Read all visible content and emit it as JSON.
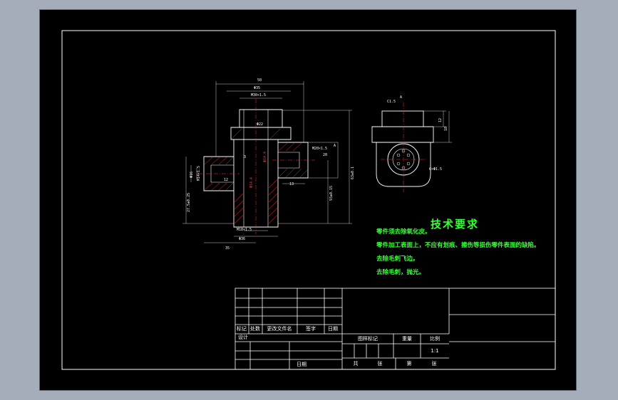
{
  "tech_requirements": {
    "title": "技术要求",
    "lines": [
      "零件须去除氧化皮。",
      "零件加工表面上，不应有划痕、擦伤等损伤零件表面的缺陷。",
      "去除毛刺飞边。",
      "去除毛刺，抛光。"
    ]
  },
  "title_block": {
    "revision_headers": [
      "标记",
      "处数",
      "更改文件名",
      "签字",
      "日期"
    ],
    "design_label": "设计",
    "date_label": "日期",
    "stage_mark_label": "图样标记",
    "weight_label": "重量",
    "scale_label": "比例",
    "scale_value": "1:1",
    "total_label": "共",
    "sheet_unit_1": "张",
    "sheet_no_label": "第",
    "sheet_unit_2": "张"
  },
  "dimensions": {
    "overall_width": "50",
    "top_bore": "Φ35",
    "top_thread": "M30×1.5",
    "inner_bore": "Φ22",
    "right_thread": "M20×1.5",
    "right_depth": "20",
    "left_dia": "Φ16",
    "left_thread": "M14×1.5",
    "bottom_thread": "M18×1.5",
    "bottom_dia": "Φ36",
    "left_length": "35",
    "mid_dim_a": "3",
    "mid_dim_b": "12",
    "mid_dim_c": "13",
    "height_a": "63±0.1",
    "height_b": "93±0.15",
    "height_c": "27.5±0.25",
    "inner_dim_a": "Φ14.4",
    "inner_dim_b": "Φ14.4",
    "section_mark": "A",
    "view_mark": "A",
    "side_chamfer": "C1.5",
    "side_height": "12",
    "side_step": "18",
    "side_holes": "6×Φ1.5"
  }
}
